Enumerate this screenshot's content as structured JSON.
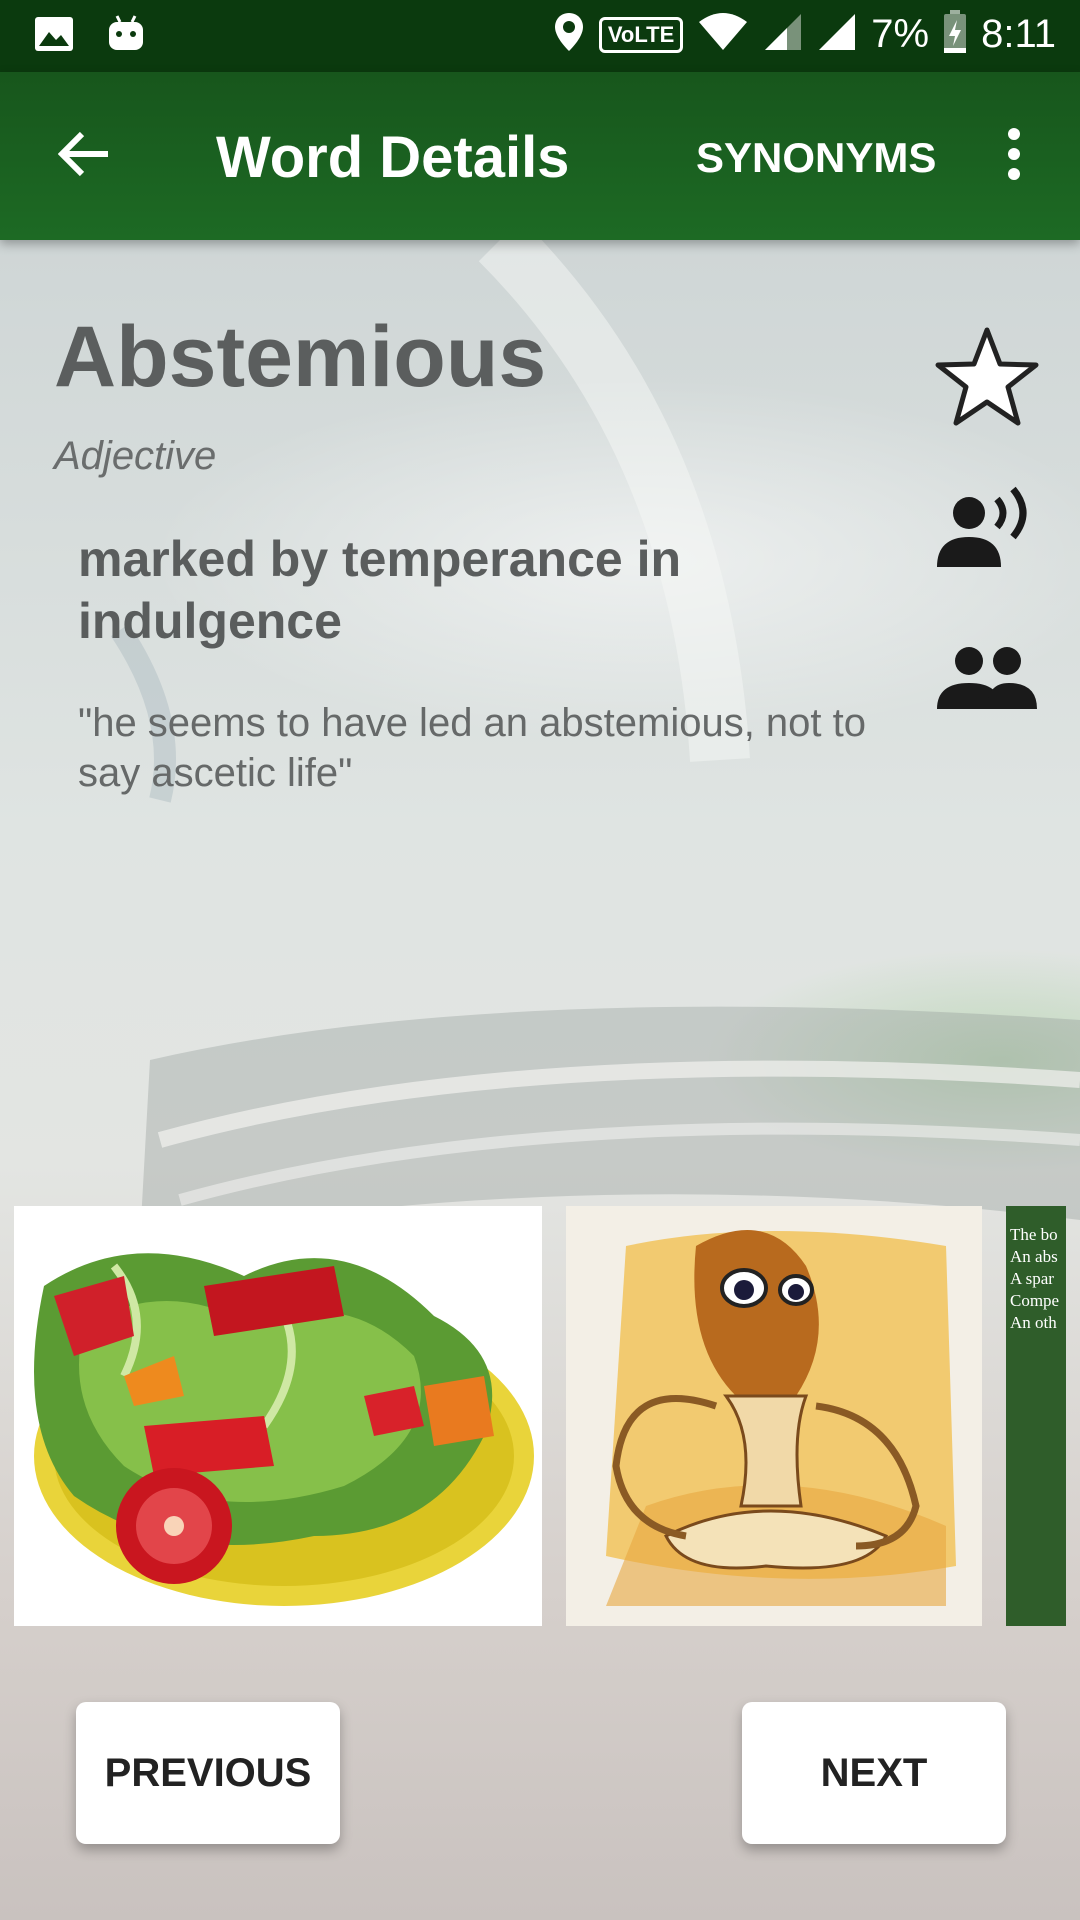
{
  "status_bar": {
    "time": "8:11",
    "battery": "7%",
    "volte": "VoLTE",
    "icons": [
      "image-icon",
      "android-icon",
      "location-icon",
      "volte-icon",
      "wifi-icon",
      "signal-icon",
      "signal-icon",
      "battery-charging-icon"
    ]
  },
  "app_bar": {
    "title": "Word Details",
    "synonyms_label": "SYNONYMS",
    "back_icon": "arrow-back-icon",
    "more_icon": "more-vertical-icon"
  },
  "word": {
    "title": "Abstemious",
    "part_of_speech": "Adjective",
    "definition": "marked by temperance in indulgence",
    "example": "\"he seems to have led an abstemious, not to say ascetic life\""
  },
  "side_actions": [
    "star-icon",
    "speaker-voice-icon",
    "people-icon"
  ],
  "images": {
    "third_text_lines": [
      "The bo",
      "An abs",
      "A spar",
      "Compe",
      "An oth"
    ]
  },
  "buttons": {
    "previous": "PREVIOUS",
    "next": "NEXT"
  },
  "colors": {
    "status_bar": "#0b3a0e",
    "app_bar": "#1d6a24",
    "title_text": "#5b5e5e"
  }
}
